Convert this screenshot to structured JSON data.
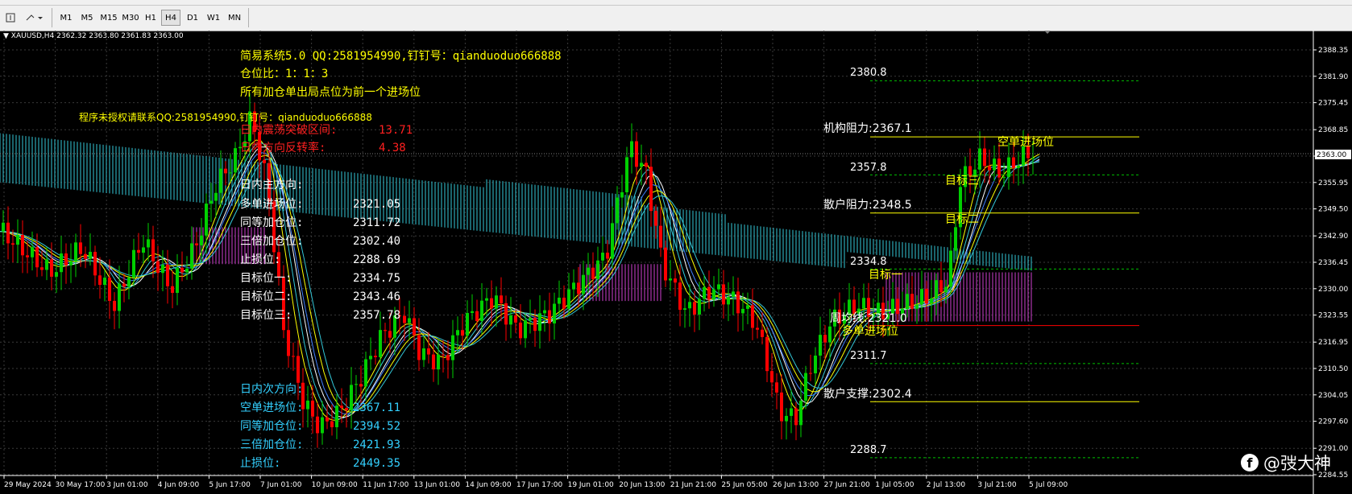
{
  "toolbar": {
    "timeframes": [
      "M1",
      "M5",
      "M15",
      "M30",
      "H1",
      "H4",
      "D1",
      "W1",
      "MN"
    ],
    "active_timeframe": "H4"
  },
  "symbol_info": "XAUUSD,H4  2362.32 2363.80 2361.83 2363.00",
  "price_axis": {
    "labels": [
      "2388.35",
      "2381.90",
      "2375.45",
      "2368.85",
      "2362.40",
      "2355.95",
      "2349.50",
      "2342.90",
      "2336.45",
      "2330.00",
      "2323.55",
      "2316.95",
      "2310.50",
      "2304.05",
      "2297.60",
      "2291.00",
      "2284.55"
    ],
    "current_price": "2363.00"
  },
  "date_axis": [
    "29 May 2024",
    "30 May 17:00",
    "3 Jun 01:00",
    "4 Jun 09:00",
    "5 Jun 17:00",
    "7 Jun 01:00",
    "10 Jun 09:00",
    "11 Jun 17:00",
    "13 Jun 01:00",
    "14 Jun 09:00",
    "17 Jun 17:00",
    "19 Jun 01:00",
    "20 Jun 13:00",
    "21 Jun 21:00",
    "25 Jun 05:00",
    "26 Jun 13:00",
    "27 Jun 21:00",
    "1 Jul 05:00",
    "2 Jul 13:00",
    "3 Jul 21:00",
    "5 Jul 09:00"
  ],
  "header_text": {
    "line1": "简易系统5.0 QQ:2581954990,钉钉号：qianduoduo666888",
    "line2": "仓位比：1：1：3",
    "line3": "所有加仓单出局点位为前一个进场位",
    "license": "程序未授权请联系QQ:2581954990,钉钉号：qianduoduo666888",
    "red1_label": "日内震荡突破区间:",
    "red1_value": "13.71",
    "red2_label": "日内方向反转率:",
    "red2_value": "4.38"
  },
  "primary_plan": {
    "title": "日内主方向:",
    "rows": [
      {
        "label": "多单进场位:",
        "value": "2321.05"
      },
      {
        "label": "同等加仓位:",
        "value": "2311.72"
      },
      {
        "label": "三倍加仓位:",
        "value": "2302.40"
      },
      {
        "label": "止损位:",
        "value": "2288.69"
      },
      {
        "label": "目标位一:",
        "value": "2334.75"
      },
      {
        "label": "目标位二:",
        "value": "2343.46"
      },
      {
        "label": "目标位三:",
        "value": "2357.78"
      }
    ]
  },
  "secondary_plan": {
    "title": "日内次方向:",
    "rows": [
      {
        "label": "空单进场位:",
        "value": "2367.11"
      },
      {
        "label": "同等加仓位:",
        "value": "2394.52"
      },
      {
        "label": "三倍加仓位:",
        "value": "2421.93"
      },
      {
        "label": "止损位:",
        "value": "2449.35"
      }
    ]
  },
  "levels": {
    "l2380": "2380.8",
    "inst_res": "机构阻力:2367.1",
    "short_entry": "空单进场位",
    "l2357": "2357.8",
    "target3": "目标三",
    "retail_res": "散户阻力:2348.5",
    "target2": "目标二",
    "l2334": "2334.8",
    "target1": "目标一",
    "weekly": "周均线:2321.0",
    "long_entry": "多单进场位",
    "l2311": "2311.7",
    "retail_sup": "散户支撑:2302.4",
    "l2288": "2288.7"
  },
  "watermark": "@弢大神",
  "colors": {
    "bull": "#00d000",
    "bear": "#ff0000",
    "cloud": "#33c8d8",
    "yellow": "#ffff00",
    "grid": "#3a3a3a"
  }
}
